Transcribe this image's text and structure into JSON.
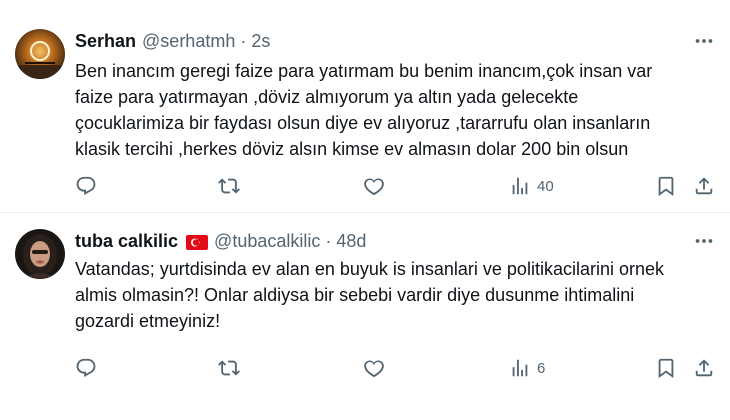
{
  "tweets": [
    {
      "name": "Serhan",
      "handle": "@serhatmh",
      "separator": "·",
      "time": "2s",
      "text": "Ben inancım geregi faize para yatırmam bu benim inancım,çok insan var\nfaize para yatırmayan ,döviz almıyorum ya altın yada gelecekte\nçocuklarimiza bir faydası olsun diye ev alıyoruz ,tararrufu olan insanların\nklasik tercihi ,herkes döviz alsın kimse ev almasın dolar 200 bin olsun",
      "views": "40",
      "avatar_colors": {
        "bg": "#2b1a0f",
        "glow": "#e8a23a"
      }
    },
    {
      "name": "tuba calkilic",
      "flag_icon": "turkey-flag-icon",
      "handle": "@tubacalkilic",
      "separator": "·",
      "time": "48d",
      "text": "Vatandas; yurtdisinda ev alan  en buyuk is insanlari ve politikacilarini  ornek\nalmis olmasin?! Onlar aldiysa bir sebebi vardir diye dusunme ihtimalini\ngozardi etmeyiniz!",
      "views": "6",
      "avatar_colors": {
        "bg": "#1a1614",
        "skin": "#c99b80"
      }
    }
  ],
  "icons": [
    "more-icon",
    "reply-icon",
    "retweet-icon",
    "like-icon",
    "views-icon",
    "bookmark-icon",
    "share-icon"
  ],
  "colors": {
    "text": "#0f1419",
    "muted": "#536471",
    "divider": "#eff3f4",
    "flag_red": "#e30a17"
  }
}
